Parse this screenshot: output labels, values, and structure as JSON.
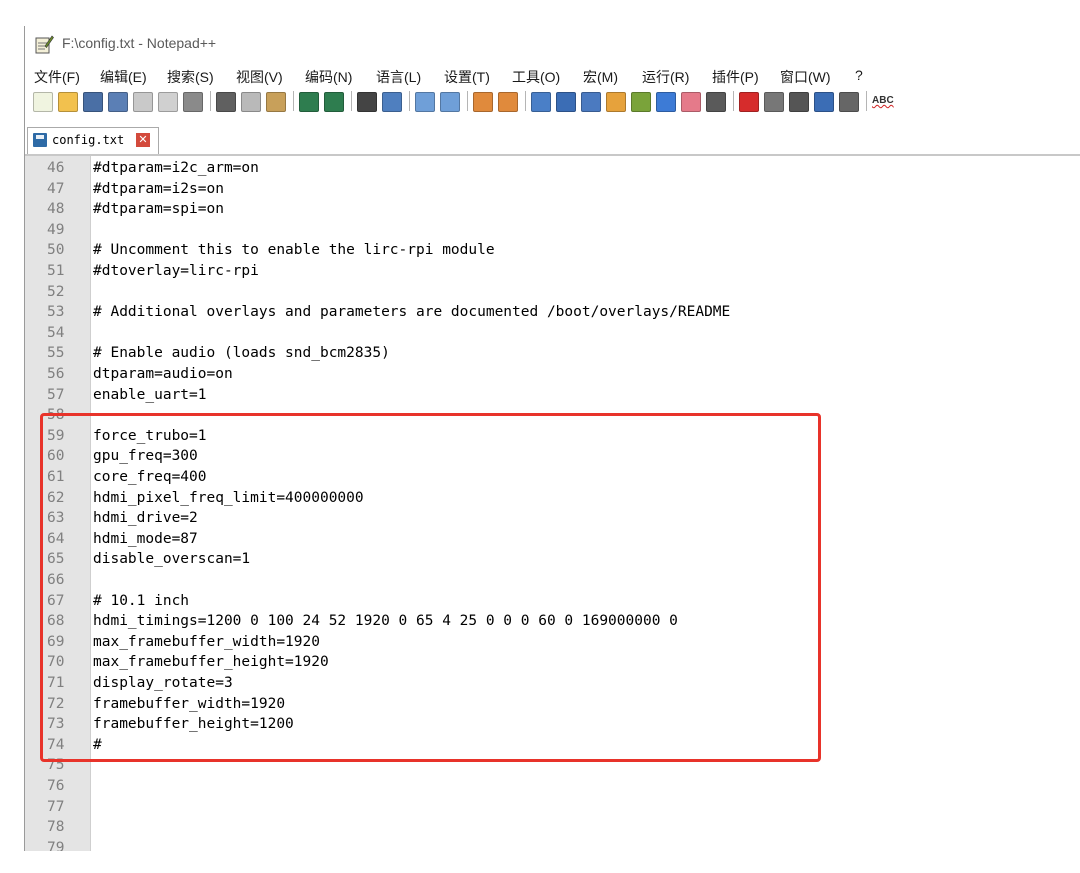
{
  "window": {
    "title": "F:\\config.txt - Notepad++"
  },
  "menu": [
    "文件(F)",
    "编辑(E)",
    "搜索(S)",
    "视图(V)",
    "编码(N)",
    "语言(L)",
    "设置(T)",
    "工具(O)",
    "宏(M)",
    "运行(R)",
    "插件(P)",
    "窗口(W)",
    "?"
  ],
  "toolbar": {
    "icons": [
      "new-file-icon",
      "open-file-icon",
      "save-icon",
      "save-all-icon",
      "close-icon",
      "close-all-icon",
      "print-icon",
      "sep",
      "cut-icon",
      "copy-icon",
      "paste-icon",
      "sep",
      "undo-icon",
      "redo-icon",
      "sep",
      "find-icon",
      "replace-icon",
      "sep",
      "zoom-in-icon",
      "zoom-out-icon",
      "sep",
      "sync-v-icon",
      "sync-h-icon",
      "sep",
      "word-wrap-icon",
      "show-all-chars-icon",
      "indent-guide-icon",
      "udl-icon",
      "doc-map-icon",
      "function-list-icon",
      "folder-workspace-icon",
      "monitoring-icon",
      "sep",
      "record-macro-icon",
      "stop-record-icon",
      "play-macro-icon",
      "run-macro-multiple-icon",
      "save-macro-icon",
      "sep",
      "spellcheck-icon"
    ],
    "spellcheck_text": "ABC"
  },
  "tab": {
    "label": "config.txt",
    "close_glyph": "✕"
  },
  "editor": {
    "lines": [
      {
        "n": "46",
        "text": "#dtparam=i2c_arm=on"
      },
      {
        "n": "47",
        "text": "#dtparam=i2s=on"
      },
      {
        "n": "48",
        "text": "#dtparam=spi=on"
      },
      {
        "n": "49",
        "text": ""
      },
      {
        "n": "50",
        "text": "# Uncomment this to enable the lirc-rpi module"
      },
      {
        "n": "51",
        "text": "#dtoverlay=lirc-rpi"
      },
      {
        "n": "52",
        "text": ""
      },
      {
        "n": "53",
        "text": "# Additional overlays and parameters are documented /boot/overlays/README"
      },
      {
        "n": "54",
        "text": ""
      },
      {
        "n": "55",
        "text": "# Enable audio (loads snd_bcm2835)"
      },
      {
        "n": "56",
        "text": "dtparam=audio=on"
      },
      {
        "n": "57",
        "text": "enable_uart=1"
      },
      {
        "n": "58",
        "text": ""
      },
      {
        "n": "59",
        "text": "force_trubo=1"
      },
      {
        "n": "60",
        "text": "gpu_freq=300"
      },
      {
        "n": "61",
        "text": "core_freq=400"
      },
      {
        "n": "62",
        "text": "hdmi_pixel_freq_limit=400000000"
      },
      {
        "n": "63",
        "text": "hdmi_drive=2"
      },
      {
        "n": "64",
        "text": "hdmi_mode=87"
      },
      {
        "n": "65",
        "text": "disable_overscan=1"
      },
      {
        "n": "66",
        "text": ""
      },
      {
        "n": "67",
        "text": "# 10.1 inch"
      },
      {
        "n": "68",
        "text": "hdmi_timings=1200 0 100 24 52 1920 0 65 4 25 0 0 0 60 0 169000000 0"
      },
      {
        "n": "69",
        "text": "max_framebuffer_width=1920"
      },
      {
        "n": "70",
        "text": "max_framebuffer_height=1920"
      },
      {
        "n": "71",
        "text": "display_rotate=3"
      },
      {
        "n": "72",
        "text": "framebuffer_width=1920"
      },
      {
        "n": "73",
        "text": "framebuffer_height=1200"
      },
      {
        "n": "74",
        "text": "#"
      },
      {
        "n": "75",
        "text": ""
      },
      {
        "n": "76",
        "text": ""
      },
      {
        "n": "77",
        "text": ""
      },
      {
        "n": "78",
        "text": ""
      },
      {
        "n": "79",
        "text": ""
      }
    ]
  },
  "colors": {
    "highlight_border": "#e8332a",
    "gutter_bg": "#e4e4e4",
    "line_number": "#808080"
  }
}
